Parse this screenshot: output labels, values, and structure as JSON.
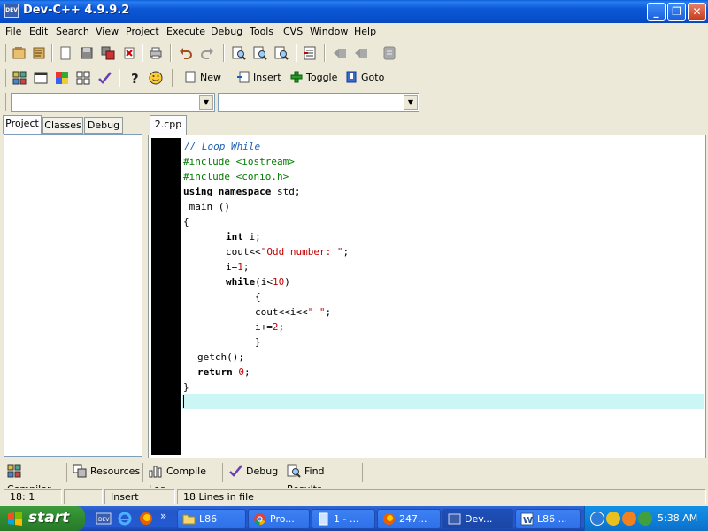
{
  "window": {
    "title": "Dev-C++ 4.9.9.2",
    "app_icon_label": "DEV",
    "minimize": "_",
    "maximize": "❐",
    "close": "✕"
  },
  "menu": [
    "File",
    "Edit",
    "Search",
    "View",
    "Project",
    "Execute",
    "Debug",
    "Tools",
    "CVS",
    "Window",
    "Help"
  ],
  "toolbar2": {
    "new_label": "New",
    "insert_label": "Insert",
    "toggle_label": "Toggle",
    "goto_label": "Goto"
  },
  "left_panel": {
    "tabs": [
      "Project",
      "Classes",
      "Debug"
    ]
  },
  "editor": {
    "file_tab": "2.cpp"
  },
  "code": {
    "l1": "// Loop While",
    "l2": "#include <iostream>",
    "l3": "#include <conio.h>",
    "l4_kw1": "using",
    "l4_kw2": "namespace",
    "l4_rest": " std;",
    "l5": " main ()",
    "l6": "{",
    "l7_kw": "int",
    "l7_rest": " i;",
    "l8_a": "cout<<",
    "l8_str": "\"Odd number: \"",
    "l8_b": ";",
    "l9_a": "i=",
    "l9_num": "1",
    "l9_b": ";",
    "l10_kw": "while",
    "l10_a": "(i<",
    "l10_num": "10",
    "l10_b": ")",
    "l11": "{",
    "l12_a": "cout<<i<<",
    "l12_str": "\" \"",
    "l12_b": ";",
    "l13_a": "i+=",
    "l13_num": "2",
    "l13_b": ";",
    "l14": "}",
    "l15": "getch();",
    "l16_kw": "return",
    "l16_num": "0",
    "l16_b": ";",
    "l17": "}"
  },
  "bottom_tabs": [
    "Compiler",
    "Resources",
    "Compile Log",
    "Debug",
    "Find Results"
  ],
  "status": {
    "position": "18: 1",
    "mode": "Insert",
    "lines": "18 Lines in file"
  },
  "taskbar": {
    "start_label": "start",
    "ql_more": "»",
    "tasks": [
      "L86",
      "Pro...",
      "1 - ...",
      "247...",
      "Dev...",
      "L86 ..."
    ],
    "clock": "5:38 AM"
  },
  "colors": {
    "comment": "#1c5fb4",
    "preprocessor": "#007a00",
    "string": "#c00000",
    "current_line": "#ccf5f5"
  }
}
